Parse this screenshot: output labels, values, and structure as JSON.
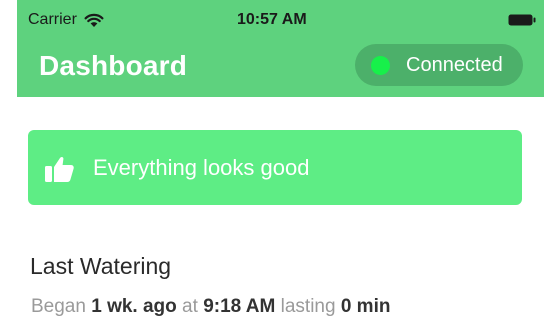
{
  "status_bar": {
    "carrier": "Carrier",
    "time": "10:57 AM"
  },
  "header": {
    "title": "Dashboard",
    "connection_label": "Connected",
    "connection_status_color": "#17f04a",
    "background_color": "#5ed27e"
  },
  "banner": {
    "icon": "thumbs-up-icon",
    "text": "Everything looks good",
    "background_color": "#5eed85"
  },
  "last_watering": {
    "title": "Last Watering",
    "began_prefix": "Began",
    "began_value": "1 wk. ago",
    "at_word": "at",
    "time_value": "9:18 AM",
    "lasting_word": "lasting",
    "duration_value": "0 min"
  }
}
